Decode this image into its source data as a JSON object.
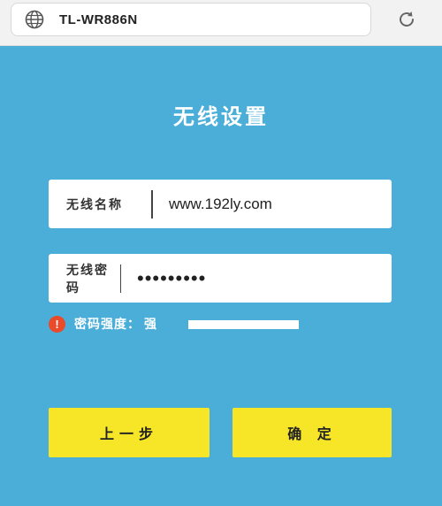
{
  "browser": {
    "url": "TL-WR886N",
    "icons": {
      "site": "globe-icon",
      "reload": "reload-icon"
    }
  },
  "page": {
    "title": "无线设置",
    "ssid": {
      "label": "无线名称",
      "value": "www.192ly.com"
    },
    "password": {
      "label": "无线密码",
      "value": "•••••••••"
    },
    "strength": {
      "label": "密码强度：",
      "value": "强",
      "icon": "warning-icon"
    },
    "buttons": {
      "prev": "上一步",
      "confirm": "确 定"
    }
  },
  "colors": {
    "background": "#4aaed9",
    "button": "#f7e628",
    "warning": "#e84a2a"
  }
}
